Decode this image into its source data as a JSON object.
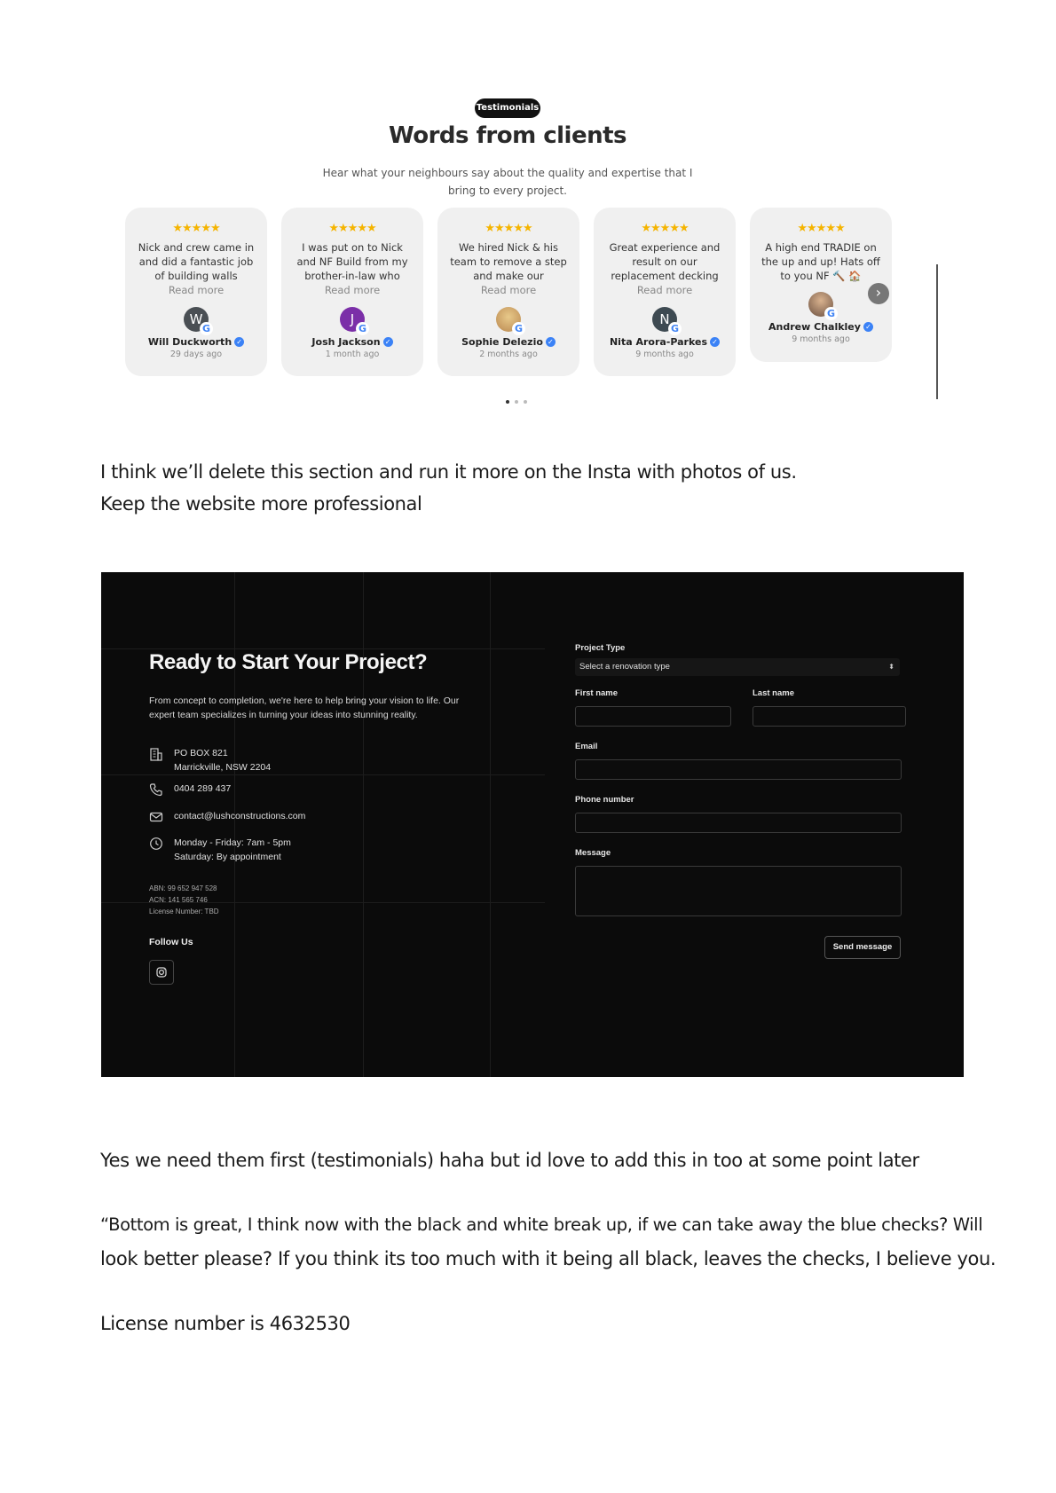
{
  "testimonials": {
    "badge": "Testimonials",
    "title": "Words from clients",
    "subtitle": "Hear what your neighbours say about the quality and expertise that I bring to every project.",
    "stars": "★★★★★",
    "read_more": "Read more",
    "google_mark": "G",
    "verified_icon": "verified-check-icon",
    "next_icon": "chevron-right-icon",
    "star_color": "#f5b400",
    "check_color": "#3b82f6",
    "cards": [
      {
        "quote": "Nick and crew came in and did a fantastic job of building walls",
        "name": "Will Duckworth",
        "initial": "W",
        "ago": "29 days ago",
        "avatar_color": "#4a4f54"
      },
      {
        "quote": "I was put on to Nick and NF Build from my brother-in-law who",
        "name": "Josh Jackson",
        "initial": "J",
        "ago": "1 month ago",
        "avatar_color": "#7b2fa8"
      },
      {
        "quote": "We hired Nick & his team to remove a step and make our",
        "name": "Sophie Delezio",
        "initial": "",
        "ago": "2 months ago",
        "avatar_color": "#c9a46a"
      },
      {
        "quote": "Great experience and result on our replacement decking",
        "name": "Nita Arora-Parkes",
        "initial": "N",
        "ago": "9 months ago",
        "avatar_color": "#3e4a52"
      },
      {
        "quote": "A high end TRADIE on the up and up! Hats off to you NF 🔨 🏠",
        "name": "Andrew Chalkley",
        "initial": "",
        "ago": "9 months ago",
        "avatar_color": "#8a6a55"
      }
    ]
  },
  "notes": {
    "line1": "I think we’ll delete this section and run it more on the Insta with photos of us.",
    "line2": "Keep the website more professional",
    "line3": "Yes we need them first (testimonials) haha but id love to add this in too at some point later",
    "line4a": "“Bottom is great, I think now with the black and white break up, if we can take away the blue checks? Will",
    "line4b": "look better please? If you think its too much with it being all black, leaves the checks, I believe you.",
    "line5": "License number is 4632530"
  },
  "contact": {
    "title": "Ready to Start Your Project?",
    "description": "From concept to completion, we're here to help bring your vision to life. Our expert team specializes in turning your ideas into stunning reality.",
    "address_line1": "PO BOX 821",
    "address_line2": "Marrickville, NSW 2204",
    "phone": "0404 289 437",
    "email": "contact@lushconstructions.com",
    "hours_line1": "Monday - Friday: 7am - 5pm",
    "hours_line2": "Saturday: By appointment",
    "abn": "ABN: 99 652 947 528",
    "acn": "ACN: 141 565 746",
    "license": "License Number: TBD",
    "follow_us": "Follow Us",
    "form": {
      "project_type_label": "Project Type",
      "project_type_value": "Select a renovation type",
      "first_name_label": "First name",
      "last_name_label": "Last name",
      "email_label": "Email",
      "phone_label": "Phone number",
      "message_label": "Message",
      "send_label": "Send message"
    }
  }
}
